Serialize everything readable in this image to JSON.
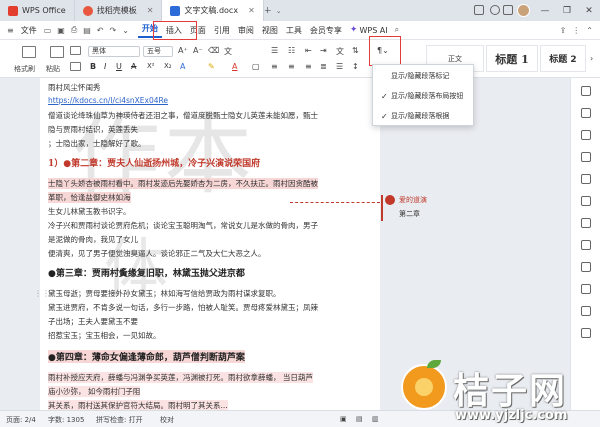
{
  "tabs": [
    {
      "label": "WPS Office"
    },
    {
      "label": "找稻壳模板"
    },
    {
      "label": "文字文稿.docx"
    }
  ],
  "menubar": {
    "file": "文件",
    "items": [
      "开始",
      "插入",
      "页面",
      "引用",
      "审阅",
      "视图",
      "工具",
      "会员专享"
    ],
    "wps_ai": "WPS AI"
  },
  "ribbon": {
    "format_painter": "格式刷",
    "paste": "粘贴",
    "font_name": "黑体",
    "font_size": "五号",
    "style_normal": "正文",
    "style_h1": "标题 1",
    "style_h2": "标题 2"
  },
  "dropdown": {
    "items": [
      {
        "label": "显示/隐藏段落标记",
        "checked": false
      },
      {
        "label": "显示/隐藏段落布局按钮",
        "checked": true
      },
      {
        "label": "显示/隐藏段落根据",
        "checked": true
      }
    ]
  },
  "document": {
    "watermark": "作本",
    "watermark2": "体",
    "lines": [
      "雨村风尘怀闺秀",
      "https://kdocs.cn/l/ci4snXEx04Re",
      "僧道谈论绛珠仙草为神瑛侍者还泪之事，僧道度脱甄士隐女儿英莲未能如愿，甄士",
      "隐与贾雨村结识，英莲丢失",
      "；士隐出家，士隐解好了歌。",
      "1）●第二章：贾夫人仙逝扬州城，冷子兴演说荣国府",
      "士隐丫头娇杏被雨村看中。雨村发迹后先娶娇杏为二房，不久扶正。雨村因贪酷被",
      "革职，恰逢盐御史林如海",
      "生女儿林黛玉教书识字。",
      "冷子兴和贾雨村谈论贾府危机；谈论宝玉聪明淘气，常说女儿是水做的骨肉，男子",
      "是泥做的骨肉，我见了女儿",
      "便清爽，见了男子便觉浊臭逼人。谈论邪正二气及大仁大恶之人。",
      "●第三章：贾雨村夤缘复旧职，林黛玉抛父进京都",
      "黛玉母逝；贾母要接外孙女黛玉；林如海写信给贾政为雨村谋求复职。",
      "黛玉进贾府，不肯多说一句话，多行一步路，怕被人耻笑。贾母疼爱林黛玉；凤辣",
      "子出场；王夫人要黛玉不要",
      "招惹宝玉；宝玉相会，一见如故。",
      "●第四章：薄命女偏逢薄命郎，葫芦僧判断葫芦案",
      "雨村补授应天府，薛蟠与冯渊争买英莲，冯渊被打死。雨村欲拿薛蟠，  当日葫芦",
      "庙小沙弥，  如今雨村门子阻",
      "其关系，雨村送其保护官符大结局。雨村明了其关系..."
    ]
  },
  "comment": {
    "user": "爱的道演",
    "text": "第二章"
  },
  "statusbar": {
    "page": "页面: 2/4",
    "words": "字数: 1305",
    "spellcheck": "拼写检查: 打开",
    "proof": "校对"
  },
  "logo": {
    "title": "桔子网",
    "url": "www.yjzljc.com"
  },
  "colors": {
    "accent": "#1a5fd0",
    "highlight_box": "#e43a3a",
    "heading_red": "#c0392b"
  }
}
